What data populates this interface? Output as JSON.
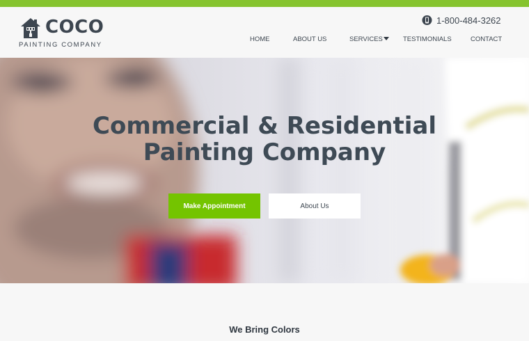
{
  "brand": {
    "name": "COCO",
    "tagline": "PAINTING COMPANY",
    "logo_icon": "house-paintbrush-icon",
    "accent_color": "#86c42f"
  },
  "header": {
    "phone_icon": "phone-icon",
    "phone": "1-800-484-3262"
  },
  "nav": {
    "items": [
      {
        "label": "HOME"
      },
      {
        "label": "ABOUT US"
      },
      {
        "label": "SERVICES",
        "has_dropdown": true
      },
      {
        "label": "TESTIMONIALS"
      },
      {
        "label": "CONTACT"
      }
    ],
    "dropdown_icon": "caret-down-icon"
  },
  "hero": {
    "headline_line1": "Commercial & Residential",
    "headline_line2": "Painting Company",
    "primary_button": "Make Appointment",
    "secondary_button": "About Us",
    "primary_color": "#74c400"
  },
  "section": {
    "title": "We Bring Colors"
  }
}
